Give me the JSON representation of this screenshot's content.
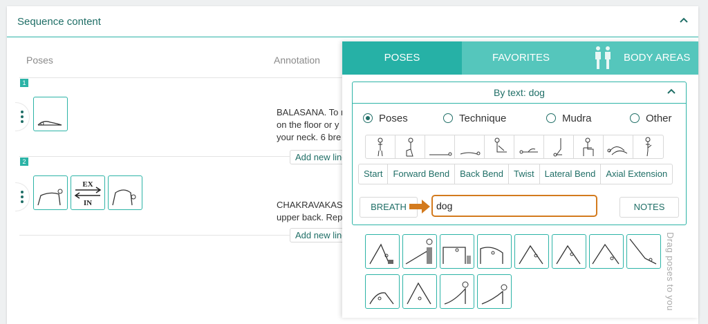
{
  "sequence": {
    "title": "Sequence content",
    "col_poses": "Poses",
    "col_annotation": "Annotation",
    "steps": [
      {
        "num": "1",
        "annotation_lines": [
          "BALASANA. To r",
          "on the floor or y",
          "your neck. 6 bre"
        ],
        "add_line": "Add new line"
      },
      {
        "num": "2",
        "breath_ex": "EX",
        "breath_in": "IN",
        "annotation_lines": [
          "CHAKRAVAKASA",
          "upper back. Rep"
        ],
        "add_line": "Add new line"
      }
    ]
  },
  "panel": {
    "tabs": [
      "POSES",
      "FAVORITES",
      "BODY AREAS"
    ],
    "active_tab": "POSES",
    "filter_title": "By text: dog",
    "radios": [
      {
        "label": "Poses",
        "selected": true
      },
      {
        "label": "Technique",
        "selected": false
      },
      {
        "label": "Mudra",
        "selected": false
      },
      {
        "label": "Other",
        "selected": false
      }
    ],
    "category_icons": [
      "standing-pose-icon",
      "kneeling-pose-icon",
      "supine-pose-icon",
      "prone-pose-icon",
      "seated-pose-icon",
      "side-lying-pose-icon",
      "inversion-pose-icon",
      "chair-pose-icon",
      "twist-pose-icon",
      "balance-pose-icon"
    ],
    "subcategories": [
      "Start",
      "Forward Bend",
      "Back Bend",
      "Twist",
      "Lateral Bend",
      "Axial Extension"
    ],
    "breath_label": "BREATH",
    "search_value": "dog",
    "notes_label": "NOTES",
    "drag_hint": "Drag poses to you",
    "result_count": 12
  },
  "colors": {
    "accent": "#26b1a6",
    "accent_light": "#55c6bc",
    "accent_dark": "#1f6e66",
    "highlight": "#d37a1d"
  }
}
